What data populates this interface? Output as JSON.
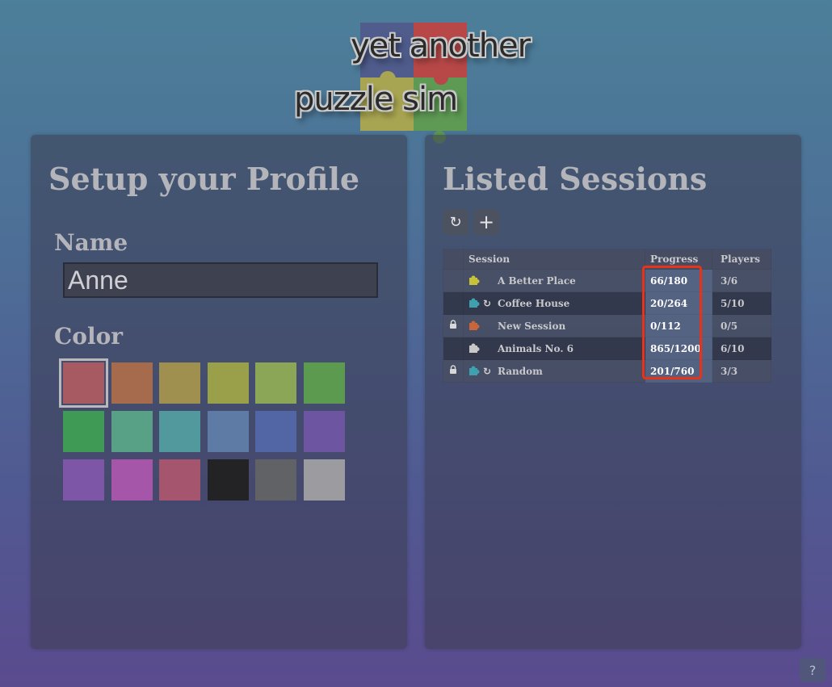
{
  "logo": {
    "line1": "yet another",
    "line2": "puzzle sim"
  },
  "profile": {
    "title": "Setup your Profile",
    "name_label": "Name",
    "name_value": "Anne",
    "color_label": "Color",
    "selected_color_index": 0,
    "colors": [
      "#a85a62",
      "#a66a4c",
      "#a0904f",
      "#9aa04a",
      "#8aa656",
      "#5c9a50",
      "#3f9a55",
      "#58a086",
      "#52999e",
      "#5e7ba6",
      "#5266a6",
      "#6e55a2",
      "#7d56a8",
      "#a556a8",
      "#a5556d",
      "#232326",
      "#616266",
      "#9b9ba0"
    ]
  },
  "sessions": {
    "title": "Listed Sessions",
    "refresh_icon": "refresh-icon",
    "add_icon": "plus-icon",
    "headers": {
      "session": "Session",
      "progress": "Progress",
      "players": "Players"
    },
    "rows": [
      {
        "locked": false,
        "piece_color": "#c7c23a",
        "synced": false,
        "name": "A Better Place",
        "progress": "66/180",
        "players": "3/6"
      },
      {
        "locked": false,
        "piece_color": "#3fa1b0",
        "synced": true,
        "name": "Coffee House",
        "progress": "20/264",
        "players": "5/10"
      },
      {
        "locked": true,
        "piece_color": "#c7663a",
        "synced": false,
        "name": "New Session",
        "progress": "0/112",
        "players": "0/5"
      },
      {
        "locked": false,
        "piece_color": "#c8c8c8",
        "synced": false,
        "name": "Animals No. 6",
        "progress": "865/1200",
        "players": "6/10"
      },
      {
        "locked": true,
        "piece_color": "#3fa1b0",
        "synced": true,
        "name": "Random",
        "progress": "201/760",
        "players": "3/3"
      }
    ],
    "highlight_color": "#e8321a"
  },
  "help": {
    "label": "?"
  }
}
